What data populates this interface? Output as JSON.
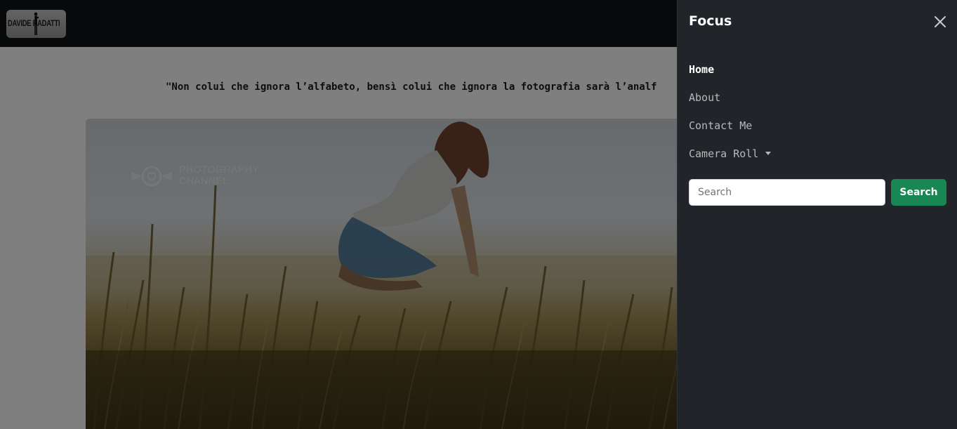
{
  "brand": {
    "logo_text": "DAVIDE RADATTI"
  },
  "main": {
    "quote": "\"Non colui che ignora l’alfabeto, bensì colui che ignora la fotografia sarà l’analf",
    "hero_watermark": {
      "line1": "PHOTOGRAPHY",
      "line2": "CHANNEL"
    }
  },
  "offcanvas": {
    "title": "Focus",
    "close_icon": "close-icon",
    "nav": [
      {
        "label": "Home",
        "active": true
      },
      {
        "label": "About",
        "active": false
      },
      {
        "label": "Contact Me",
        "active": false
      },
      {
        "label": "Camera Roll",
        "active": false,
        "dropdown": true
      }
    ],
    "search": {
      "placeholder": "Search",
      "value": "",
      "button_label": "Search"
    }
  },
  "colors": {
    "navbar_bg": "#111214",
    "offcanvas_bg": "#212529",
    "search_button": "#198754",
    "backdrop": "rgba(0,0,0,0.5)"
  }
}
